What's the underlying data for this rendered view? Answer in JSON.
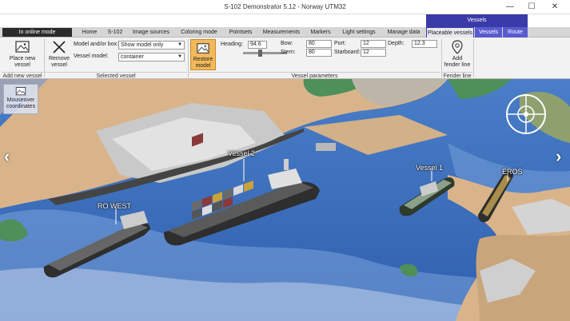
{
  "window": {
    "title": "S-102 Demonstrator 5.12 - Norway UTM32",
    "minimize": "—",
    "maximize": "☐",
    "close": "✕"
  },
  "mode": "In online mode",
  "tabs": [
    "Home",
    "S-102",
    "Image sources",
    "Coloring mode",
    "Pointsets",
    "Measurements",
    "Markers",
    "Light settings",
    "Manage data"
  ],
  "context": {
    "header": "Vessels",
    "tabs": [
      "Placeable vessels",
      "Vessels",
      "Route"
    ]
  },
  "ribbon": {
    "place_new_vessel": "Place new vessel",
    "remove_vessel": "Remove vessel",
    "model_label": "Model and/or box:",
    "model_value": "Show model only",
    "vessel_model_label": "Vessel model:",
    "vessel_model_value": "container",
    "restore_model": "Restore model",
    "heading_label": "Heading:",
    "heading_value": "94.6",
    "bow_label": "Bow:",
    "bow_value": "80",
    "stern_label": "Stern:",
    "stern_value": "80",
    "port_label": "Port:",
    "port_value": "12",
    "starboard_label": "Starboard:",
    "starboard_value": "12",
    "depth_label": "Depth:",
    "depth_value": "12.3",
    "add_fender_line": "Add fender line",
    "groups": {
      "add_new_vessel": "Add new vessel",
      "selected_vessel": "Selected vessel",
      "vessel_parameters": "Vessel parameters",
      "fender_line": "Fender line"
    }
  },
  "map": {
    "mouseover": "Mouseover coordinates",
    "vessels": [
      "Vessel 2",
      "Vessel 1",
      "RO WEST",
      "EROS"
    ],
    "nav_left": "‹",
    "nav_right": "›"
  }
}
